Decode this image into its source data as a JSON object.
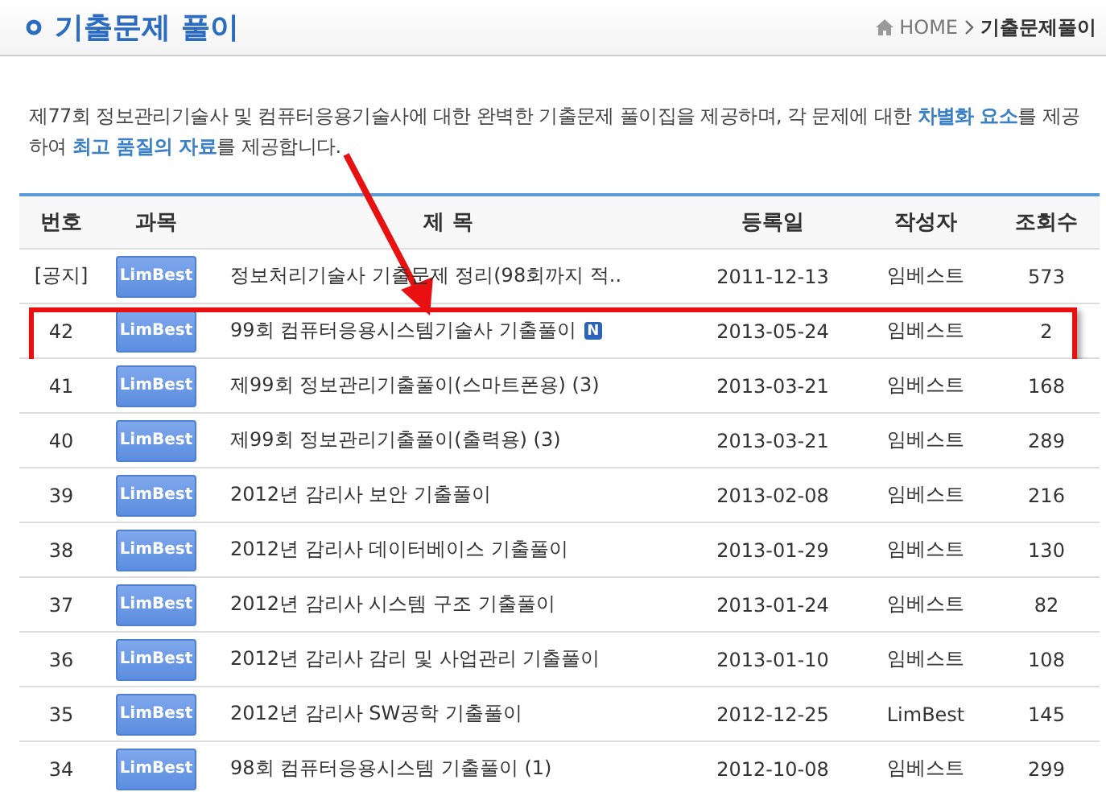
{
  "header": {
    "title": "기출문제 풀이",
    "breadcrumb": [
      {
        "label": "HOME"
      },
      {
        "label": "기출문제풀이"
      }
    ]
  },
  "intro": {
    "text": "제77회 정보관리기술사 및 컴퓨터응용기술사에 대한 완벽한 기출문제 풀이집을 제공하며, 각 문제에 대한 **차별화 요소**를 제공하여 **최고 품질의 자료**를 제공합니다."
  },
  "table": {
    "columns": [
      "번호",
      "과목",
      "제 목",
      "등록일",
      "작성자",
      "조회수"
    ],
    "rows": [
      {
        "number": "[공지]",
        "subject": "LimBest",
        "title": "정보처리기술사 기출문제 정리(98회까지 적..",
        "new": false,
        "date": "2011-12-13",
        "author": "임베스트",
        "views": "573",
        "highlighted": false
      },
      {
        "number": "42",
        "subject": "LimBest",
        "title": "99회 컴퓨터응용시스템기술사 기출풀이",
        "new": true,
        "new_badge": "N",
        "date": "2013-05-24",
        "author": "임베스트",
        "views": "2",
        "highlighted": true
      },
      {
        "number": "41",
        "subject": "LimBest",
        "title": "제99회 정보관리기출풀이(스마트폰용) (3)",
        "new": false,
        "date": "2013-03-21",
        "author": "임베스트",
        "views": "168",
        "highlighted": false
      },
      {
        "number": "40",
        "subject": "LimBest",
        "title": "제99회 정보관리기출풀이(출력용) (3)",
        "new": false,
        "date": "2013-03-21",
        "author": "임베스트",
        "views": "289",
        "highlighted": false
      },
      {
        "number": "39",
        "subject": "LimBest",
        "title": "2012년 감리사 보안 기출풀이",
        "new": false,
        "date": "2013-02-08",
        "author": "임베스트",
        "views": "216",
        "highlighted": false
      },
      {
        "number": "38",
        "subject": "LimBest",
        "title": "2012년 감리사 데이터베이스 기출풀이",
        "new": false,
        "date": "2013-01-29",
        "author": "임베스트",
        "views": "130",
        "highlighted": false
      },
      {
        "number": "37",
        "subject": "LimBest",
        "title": "2012년 감리사 시스템 구조 기출풀이",
        "new": false,
        "date": "2013-01-24",
        "author": "임베스트",
        "views": "82",
        "highlighted": false
      },
      {
        "number": "36",
        "subject": "LimBest",
        "title": "2012년 감리사 감리 및 사업관리 기출풀이",
        "new": false,
        "date": "2013-01-10",
        "author": "임베스트",
        "views": "108",
        "highlighted": false
      },
      {
        "number": "35",
        "subject": "LimBest",
        "title": "2012년 감리사 SW공학 기출풀이",
        "new": false,
        "date": "2012-12-25",
        "author": "LimBest",
        "views": "145",
        "highlighted": false
      },
      {
        "number": "34",
        "subject": "LimBest",
        "title": "98회 컴퓨터응용시스템 기출풀이 (1)",
        "new": false,
        "date": "2012-10-08",
        "author": "임베스트",
        "views": "299",
        "highlighted": false
      }
    ]
  }
}
